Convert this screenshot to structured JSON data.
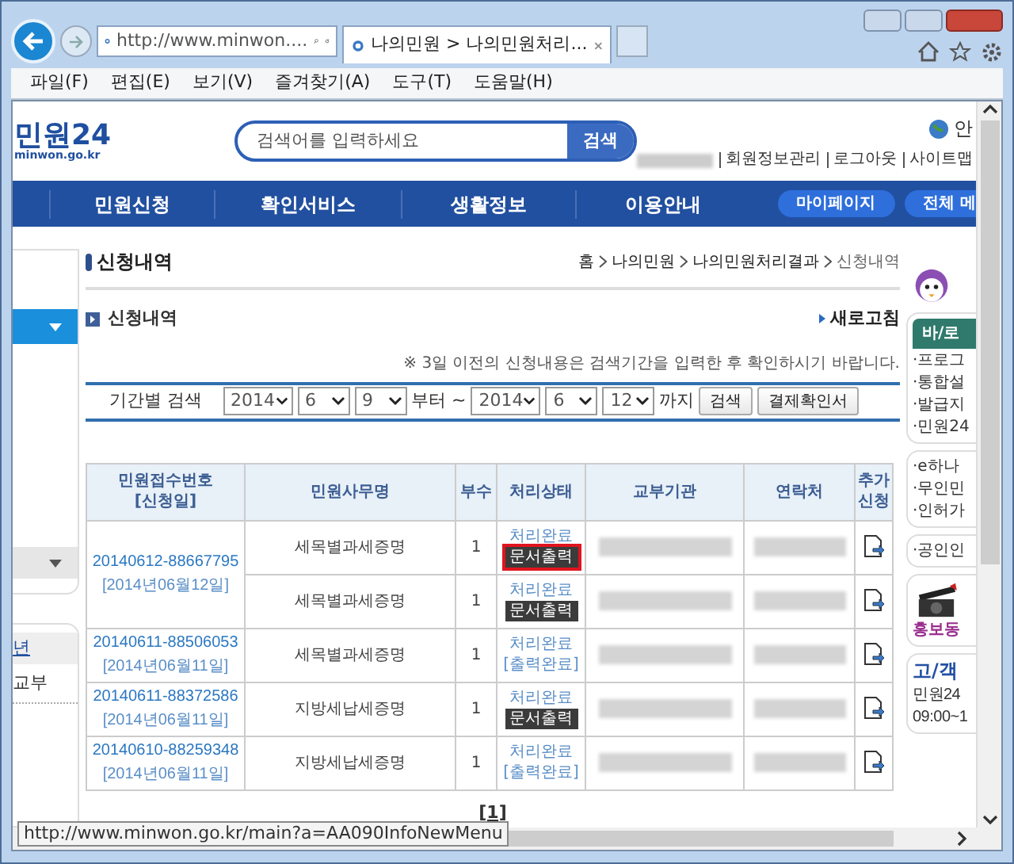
{
  "browser": {
    "address": "http://www.minwon....",
    "tab_title": "나의민원 > 나의민원처리...",
    "menu": [
      "파일(F)",
      "편집(E)",
      "보기(V)",
      "즐겨찾기(A)",
      "도구(T)",
      "도움말(H)"
    ]
  },
  "site": {
    "logo_text": "민원24",
    "logo_domain": "minwon.go.kr",
    "search": {
      "placeholder": "검색어를 입력하세요",
      "button": "검색"
    },
    "lang": "안",
    "top_links": [
      "회원정보관리",
      "로그아웃",
      "사이트맵"
    ],
    "nav": [
      "민원신청",
      "확인서비스",
      "생활정보",
      "이용안내"
    ],
    "nav_buttons": [
      "마이페이지",
      "전체 메"
    ]
  },
  "sidebar": {
    "items": [
      "년",
      "교부"
    ]
  },
  "page": {
    "title": "신청내역",
    "breadcrumb": [
      "홈",
      "나의민원",
      "나의민원처리결과",
      "신청내역"
    ],
    "section": "신청내역",
    "refresh": "새로고침",
    "notice": "※ 3일 이전의 신청내용은 검색기간을 입력한 후 확인하시기 바랍니다.",
    "filter": {
      "label": "기간별 검색",
      "from": [
        "2014",
        "6",
        "9"
      ],
      "from_suffix": "부터 ~",
      "to": [
        "2014",
        "6",
        "12"
      ],
      "to_suffix": "까지",
      "buttons": [
        "검색",
        "결제확인서"
      ]
    }
  },
  "table": {
    "columns": [
      {
        "label": "민원접수번호",
        "sub": "[신청일]"
      },
      {
        "label": "민원사무명"
      },
      {
        "label": "부수"
      },
      {
        "label": "처리상태"
      },
      {
        "label": "교부기관"
      },
      {
        "label": "연락처"
      },
      {
        "label": "추가 신청"
      }
    ],
    "groups": [
      {
        "number": "20140612-88667795",
        "date": "[2014년06월12일]",
        "items": [
          {
            "name": "세목별과세증명",
            "copies": "1",
            "status": "처리완료",
            "action": {
              "kind": "button",
              "label": "문서출력",
              "highlighted": true
            }
          },
          {
            "name": "세목별과세증명",
            "copies": "1",
            "status": "처리완료",
            "action": {
              "kind": "button",
              "label": "문서출력",
              "highlighted": false
            }
          }
        ]
      },
      {
        "number": "20140611-88506053",
        "date": "[2014년06월11일]",
        "items": [
          {
            "name": "세목별과세증명",
            "copies": "1",
            "status": "처리완료",
            "action": {
              "kind": "text",
              "label": "[출력완료]"
            }
          }
        ]
      },
      {
        "number": "20140611-88372586",
        "date": "[2014년06월11일]",
        "items": [
          {
            "name": "지방세납세증명",
            "copies": "1",
            "status": "처리완료",
            "action": {
              "kind": "button",
              "label": "문서출력",
              "highlighted": false
            }
          }
        ]
      },
      {
        "number": "20140610-88259348",
        "date": "[2014년06월11일]",
        "items": [
          {
            "name": "지방세납세증명",
            "copies": "1",
            "status": "처리완료",
            "action": {
              "kind": "text",
              "label": "[출력완료]"
            }
          }
        ]
      }
    ]
  },
  "pagination": "[1]",
  "right_panel": [
    {
      "kind": "links",
      "heading": "바/로",
      "items": [
        "·프로그",
        "·통합설",
        "·발급지",
        "·민원24"
      ]
    },
    {
      "kind": "links",
      "items": [
        "·e하나",
        "·무인민",
        "·인허가"
      ]
    },
    {
      "kind": "links",
      "items": [
        "·공인인"
      ]
    },
    {
      "kind": "video",
      "items": [
        "홍보동"
      ]
    },
    {
      "kind": "contact",
      "heading": "고/객",
      "items": [
        "민원24",
        "09:00~1"
      ]
    }
  ],
  "status_url": "http://www.minwon.go.kr/main?a=AA090InfoNewMenu"
}
